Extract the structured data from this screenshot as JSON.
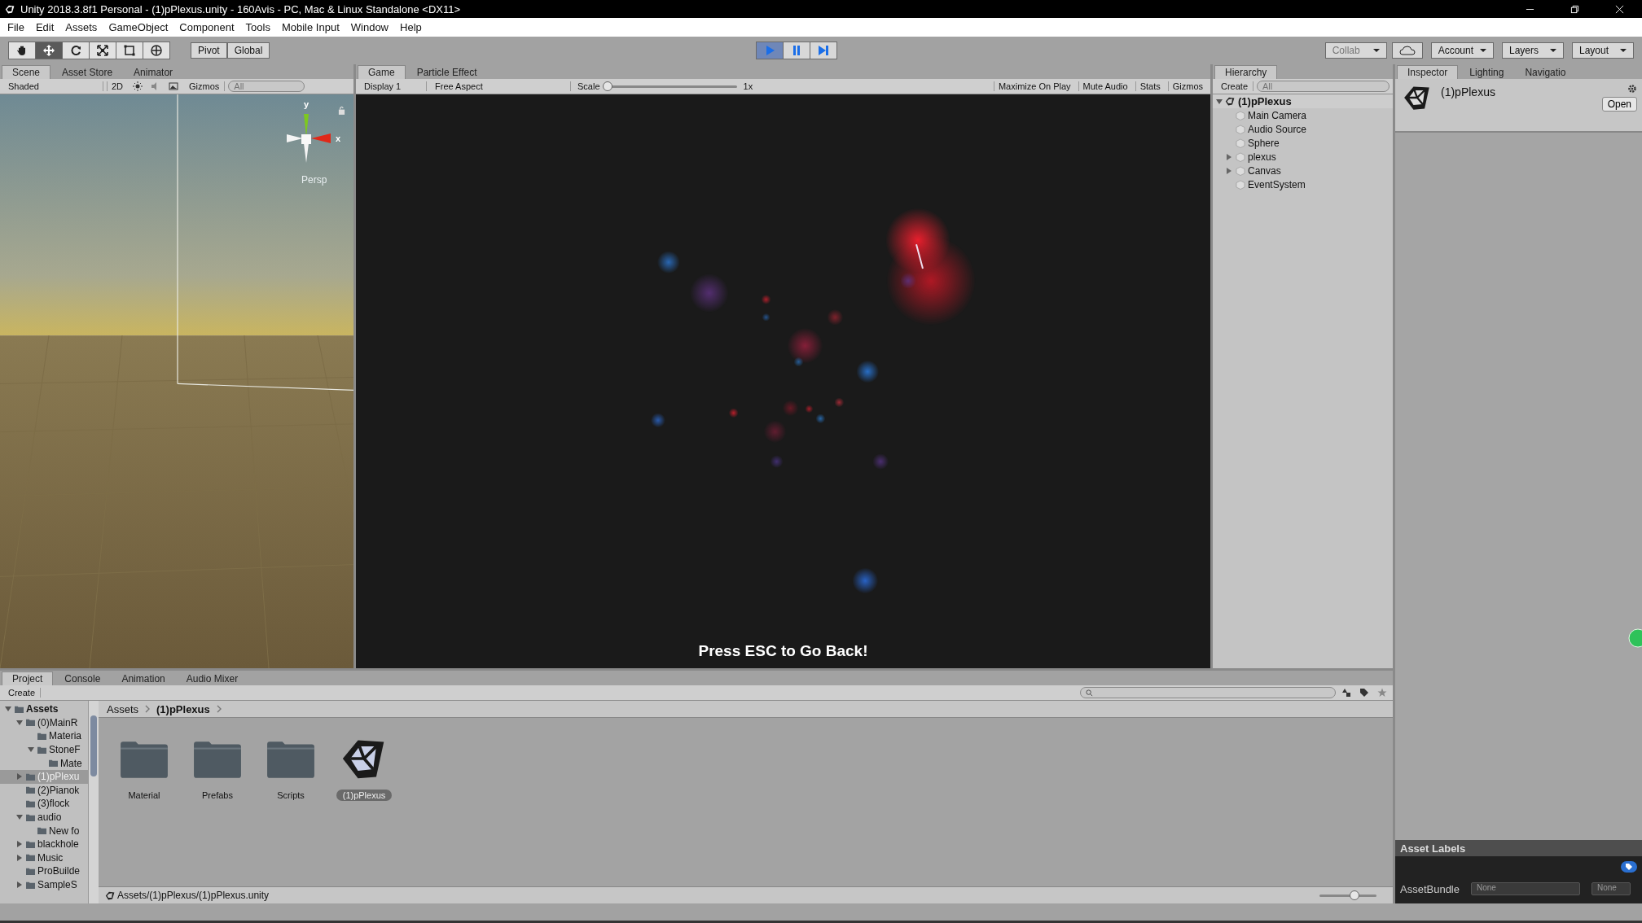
{
  "window": {
    "title": "Unity 2018.3.8f1 Personal - (1)pPlexus.unity - 160Avis - PC, Mac & Linux Standalone <DX11>"
  },
  "menu": [
    "File",
    "Edit",
    "Assets",
    "GameObject",
    "Component",
    "Tools",
    "Mobile Input",
    "Window",
    "Help"
  ],
  "toolbar": {
    "tools": [
      {
        "kind": "hand",
        "selected": false
      },
      {
        "kind": "move",
        "selected": true
      },
      {
        "kind": "rotate",
        "selected": false
      },
      {
        "kind": "scale",
        "selected": false
      },
      {
        "kind": "rect",
        "selected": false
      },
      {
        "kind": "transform",
        "selected": false
      }
    ],
    "pivot": "Pivot",
    "global": "Global",
    "play_controls": [
      {
        "kind": "play",
        "selected": true
      },
      {
        "kind": "pause",
        "selected": false
      },
      {
        "kind": "step",
        "selected": false
      }
    ],
    "collab": "Collab",
    "account": "Account",
    "layers": "Layers",
    "layout": "Layout"
  },
  "scene": {
    "tabs": [
      {
        "label": "Scene",
        "selected": true
      },
      {
        "label": "Asset Store",
        "selected": false
      },
      {
        "label": "Animator",
        "selected": false
      }
    ],
    "shading": "Shaded",
    "mode_2d": "2D",
    "gizmos": "Gizmos",
    "search_placeholder": "All",
    "axis_y": "y",
    "axis_x": "x",
    "projection": "Persp"
  },
  "game": {
    "tabs": [
      {
        "label": "Game",
        "selected": true
      },
      {
        "label": "Particle Effect",
        "selected": false
      }
    ],
    "display": "Display 1",
    "aspect": "Free Aspect",
    "scale_label": "Scale",
    "scale": {
      "level": 0.0
    },
    "scale_value": "1x",
    "buttons": [
      "Maximize On Play",
      "Mute Audio",
      "Stats",
      "Gizmos"
    ],
    "overlay_text": "Press ESC to Go Back!"
  },
  "hierarchy": {
    "tab": "Hierarchy",
    "create": "Create",
    "search_placeholder": "All",
    "scene": "(1)pPlexus",
    "items": [
      {
        "name": "Main Camera"
      },
      {
        "name": "Audio Source"
      },
      {
        "name": "Sphere"
      },
      {
        "name": "plexus",
        "expanded": false
      },
      {
        "name": "Canvas",
        "expanded": false
      },
      {
        "name": "EventSystem"
      }
    ]
  },
  "inspector": {
    "tabs": [
      {
        "label": "Inspector",
        "selected": true
      },
      {
        "label": "Lighting",
        "selected": false
      },
      {
        "label": "Navigatio",
        "selected": false
      }
    ],
    "asset_name": "(1)pPlexus",
    "open_button": "Open",
    "asset_labels": "Asset Labels",
    "asset_bundle_label": "AssetBundle",
    "asset_bundle": "None",
    "variant": "None"
  },
  "project": {
    "tabs": [
      {
        "label": "Project",
        "selected": true
      },
      {
        "label": "Console",
        "selected": false
      },
      {
        "label": "Animation",
        "selected": false
      },
      {
        "label": "Audio Mixer",
        "selected": false
      }
    ],
    "create": "Create",
    "tree": [
      {
        "label": "Assets",
        "expanded": true,
        "selected": false,
        "children": [
          {
            "label": "(0)MainR",
            "expanded": true,
            "selected": false,
            "children": [
              {
                "label": "Materia",
                "selected": false
              },
              {
                "label": "StoneF",
                "expanded": true,
                "selected": false,
                "children": [
                  {
                    "label": "Mate",
                    "selected": false
                  }
                ]
              }
            ]
          },
          {
            "label": "(1)pPlexu",
            "expanded": false,
            "selected": true
          },
          {
            "label": "(2)Pianok",
            "selected": false
          },
          {
            "label": "(3)flock",
            "selected": false
          },
          {
            "label": "audio",
            "expanded": true,
            "selected": false,
            "children": [
              {
                "label": "New fo",
                "selected": false
              }
            ]
          },
          {
            "label": "blackhole",
            "expanded": false,
            "selected": false
          },
          {
            "label": "Music",
            "expanded": false,
            "selected": false
          },
          {
            "label": "ProBuilde",
            "selected": false
          },
          {
            "label": "SampleS",
            "expanded": false,
            "selected": false
          }
        ]
      }
    ],
    "breadcrumb": [
      "Assets",
      "(1)pPlexus"
    ],
    "files": [
      {
        "label": "Material",
        "kind": "folder",
        "selected": false
      },
      {
        "label": "Prefabs",
        "kind": "folder",
        "selected": false
      },
      {
        "label": "Scripts",
        "kind": "folder",
        "selected": false
      },
      {
        "label": "(1)pPlexus",
        "kind": "scene",
        "selected": true
      }
    ],
    "path": "Assets/(1)pPlexus/(1)pPlexus.unity",
    "zoom": {
      "level": 0.6
    }
  }
}
